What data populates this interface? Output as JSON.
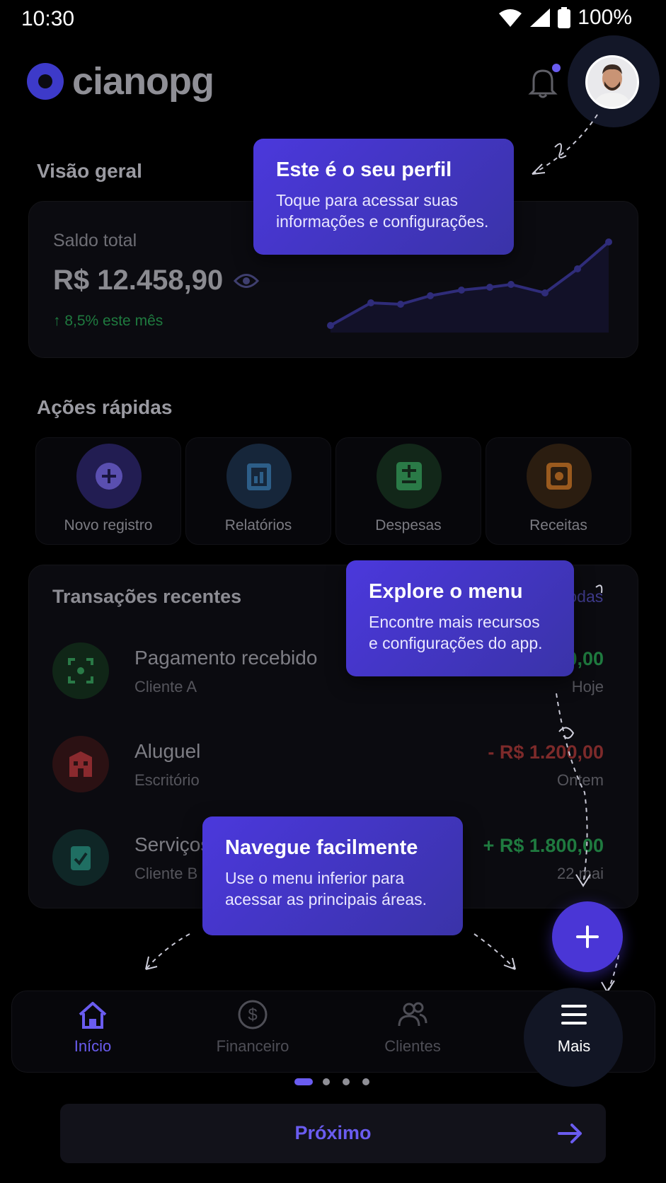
{
  "status_bar": {
    "time": "10:30",
    "battery": "100%"
  },
  "header": {
    "brand": "cianopg"
  },
  "overview": {
    "title": "Visão geral",
    "balance_label": "Saldo total",
    "balance_value": "R$ 12.458,90",
    "change_text": "8,5% este mês"
  },
  "quick_actions": {
    "title": "Ações rápidas",
    "items": [
      {
        "label": "Novo registro",
        "color": "#2a2460"
      },
      {
        "label": "Relatórios",
        "color": "#17283d"
      },
      {
        "label": "Despesas",
        "color": "#142a1e"
      },
      {
        "label": "Receitas",
        "color": "#2e2012"
      }
    ]
  },
  "transactions": {
    "title": "Transações recentes",
    "see_all": "todas",
    "items": [
      {
        "name": "Pagamento recebido",
        "sub": "Cliente A",
        "amount": "0,00",
        "date": "Hoje",
        "color": "#102617",
        "amount_color": "#1f7a3f"
      },
      {
        "name": "Aluguel",
        "sub": "Escritório",
        "amount": "- R$ 1.200,00",
        "date": "Ontem",
        "color": "#2b1113",
        "amount_color": "#7d2a2a"
      },
      {
        "name": "Serviços",
        "sub": "Cliente B",
        "amount": "+ R$ 1.800,00",
        "date": "22 mai",
        "color": "#0f2626",
        "amount_color": "#1f7a3f"
      }
    ]
  },
  "tooltips": {
    "profile": {
      "title": "Este é o seu perfil",
      "body_line1": "Toque para acessar suas",
      "body_line2": "informações e configurações."
    },
    "menu": {
      "title": "Explore o menu",
      "body_line1": "Encontre mais recursos",
      "body_line2": "e configurações do app."
    },
    "nav": {
      "title": "Navegue facilmente",
      "body_line1": "Use o menu inferior para",
      "body_line2": "acessar as principais áreas."
    }
  },
  "bottom_nav": {
    "items": [
      {
        "label": "Início",
        "active": true
      },
      {
        "label": "Financeiro",
        "active": false
      },
      {
        "label": "Clientes",
        "active": false
      },
      {
        "label": "Mais",
        "active": false,
        "highlighted": true
      }
    ]
  },
  "onboarding": {
    "pages": 4,
    "current": 1,
    "next_label": "Próximo"
  },
  "colors": {
    "accent": "#4a36d6",
    "accent_text": "#6a5cf0",
    "background": "#000000"
  }
}
